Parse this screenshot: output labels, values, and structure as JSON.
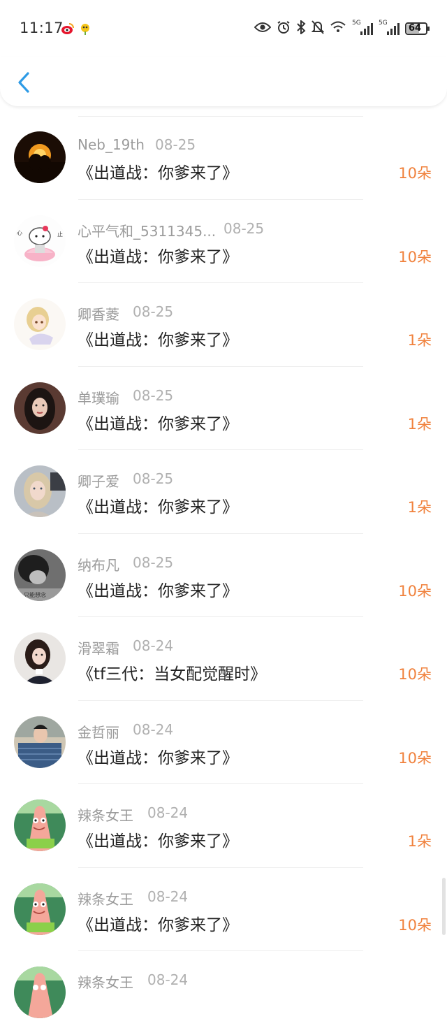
{
  "status_bar": {
    "time": "11:17",
    "signal1_label": "5G",
    "signal2_label": "5G",
    "battery": "64"
  },
  "colors": {
    "accent": "#2e9be6",
    "flowers": "#f0813c"
  },
  "items": [
    {
      "name": "Neb_19th",
      "date": "08-25",
      "title": "《出道战：你爹来了》",
      "flowers": "10朵"
    },
    {
      "name": "心平气和_5311345...",
      "date": "08-25",
      "title": "《出道战：你爹来了》",
      "flowers": "10朵"
    },
    {
      "name": "卿香菱",
      "date": "08-25",
      "title": "《出道战：你爹来了》",
      "flowers": "1朵"
    },
    {
      "name": "单璞瑜",
      "date": "08-25",
      "title": "《出道战：你爹来了》",
      "flowers": "1朵"
    },
    {
      "name": "卿子爱",
      "date": "08-25",
      "title": "《出道战：你爹来了》",
      "flowers": "1朵"
    },
    {
      "name": "纳布凡",
      "date": "08-25",
      "title": "《出道战：你爹来了》",
      "flowers": "10朵"
    },
    {
      "name": "滑翠霜",
      "date": "08-24",
      "title": "《tf三代：当女配觉醒时》",
      "flowers": "10朵"
    },
    {
      "name": "金哲丽",
      "date": "08-24",
      "title": "《出道战：你爹来了》",
      "flowers": "10朵"
    },
    {
      "name": "辣条女王",
      "date": "08-24",
      "title": "《出道战：你爹来了》",
      "flowers": "1朵"
    },
    {
      "name": "辣条女王",
      "date": "08-24",
      "title": "《出道战：你爹来了》",
      "flowers": "10朵"
    },
    {
      "name": "辣条女王",
      "date": "08-24",
      "title": "",
      "flowers": ""
    }
  ]
}
